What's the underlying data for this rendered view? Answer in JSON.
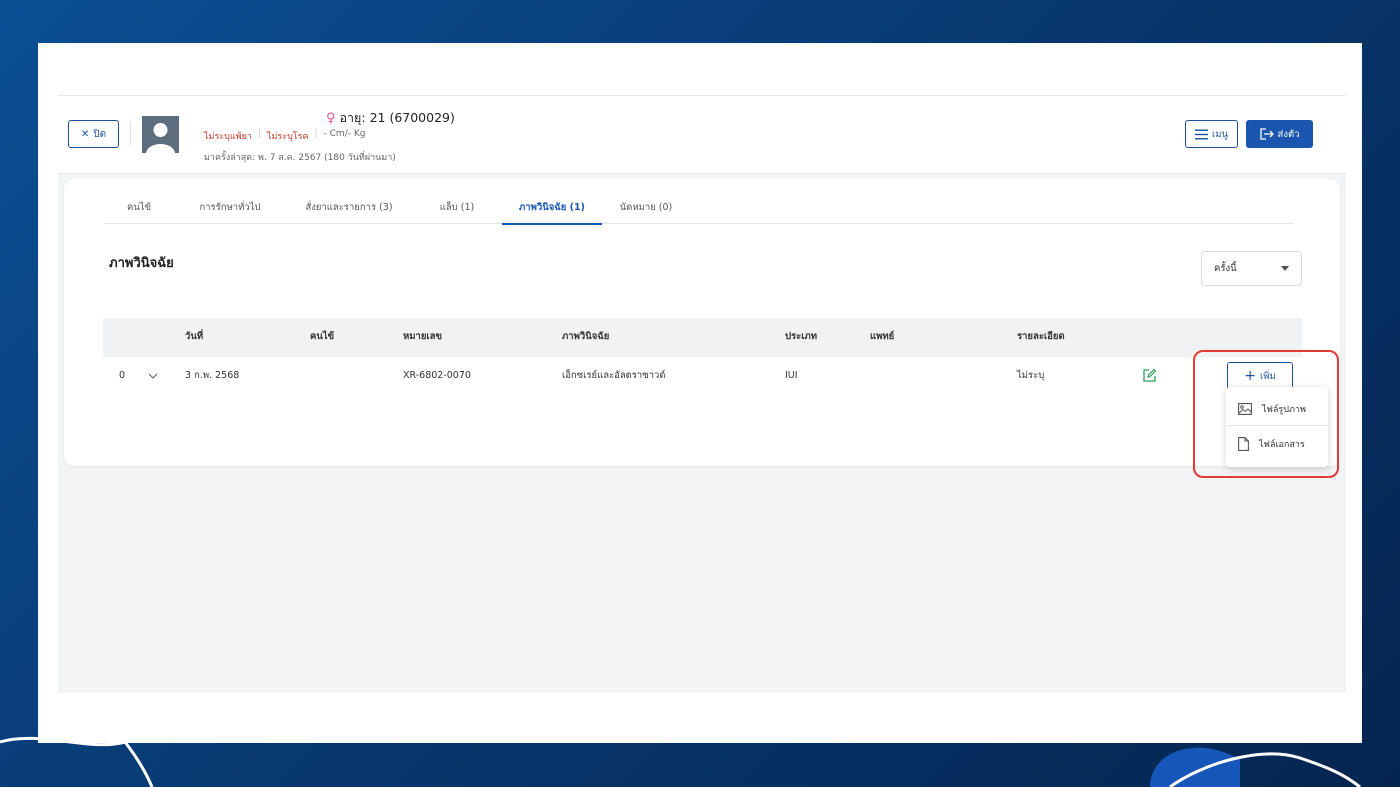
{
  "header": {
    "close_label": "ปิด",
    "age_text": "อายุ: 21 (6700029)",
    "allergy_tag": "ไม่ระบุแพ้ยา",
    "disease_tag": "ไม่ระบุโรค",
    "measurements": "- Cm/- Kg",
    "last_visit": "มาครั้งล่าสุด: พ. 7 ส.ค. 2567 (180 วันที่ผ่านมา)",
    "menu_label": "เมนู",
    "send_label": "ส่งตัว"
  },
  "tabs": [
    {
      "label": "คนไข้",
      "active": false
    },
    {
      "label": "การรักษาทั่วไป",
      "active": false
    },
    {
      "label": "สั่งยาและรายการ (3)",
      "active": false
    },
    {
      "label": "แล็บ (1)",
      "active": false
    },
    {
      "label": "ภาพวินิจฉัย (1)",
      "active": true
    },
    {
      "label": "นัดหมาย (0)",
      "active": false
    }
  ],
  "section": {
    "title": "ภาพวินิจฉัย",
    "filter_value": "ครั้งนี้"
  },
  "table": {
    "columns": [
      "วันที่",
      "คนไข้",
      "หมายเลข",
      "ภาพวินิจฉัย",
      "ประเภท",
      "แพทย์",
      "รายละเอียด"
    ],
    "rows": [
      {
        "index": "0",
        "date": "3 ก.พ. 2568",
        "patient": "",
        "number": "XR-6802-0070",
        "imaging": "เอ็กซเรย์และอัลตราซาวด์",
        "type": "IUI",
        "doctor": "",
        "detail": "ไม่ระบุ"
      }
    ]
  },
  "add_button": {
    "label": "เพิ่ม",
    "menu": [
      "ไฟล์รูปภาพ",
      "ไฟล์เอกสาร"
    ]
  },
  "colors": {
    "primary": "#1a56b0",
    "highlight": "#e53935",
    "tag_red": "#c0392b",
    "edit_green": "#2e9e5b"
  }
}
